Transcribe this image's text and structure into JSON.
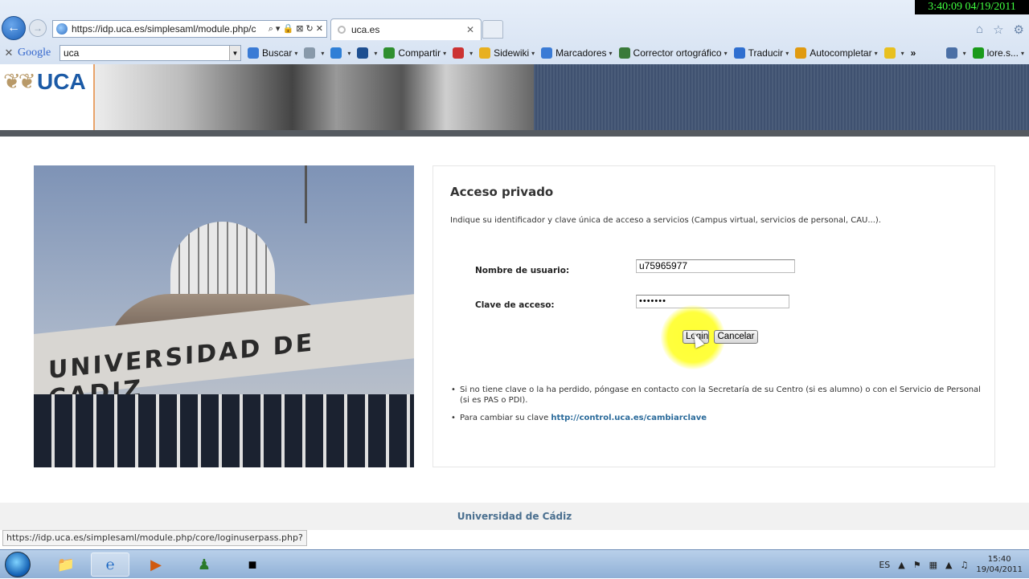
{
  "clock_overlay": "3:40:09  04/19/2011",
  "browser": {
    "address": "https://idp.uca.es/simplesaml/module.php/c",
    "tab_title": "uca.es",
    "tab_close": "✕",
    "address_tools": "⌕ ▾ 🔒 ⊠ ↻ ✕",
    "right_icons": [
      "home-icon",
      "star-icon",
      "gear-icon"
    ]
  },
  "google_toolbar": {
    "logo": "Google",
    "search_value": "uca",
    "items": [
      {
        "label": "Buscar",
        "icon": "search-icon",
        "color": "#3a7bd5"
      },
      {
        "label": "",
        "icon": "page-icon",
        "color": "#8899aa"
      },
      {
        "label": "",
        "icon": "plus-icon",
        "color": "#2f7fd6"
      },
      {
        "label": "",
        "icon": "globe-icon",
        "color": "#1d4f91"
      },
      {
        "label": "Compartir",
        "icon": "share-icon",
        "color": "#2f8f2f"
      },
      {
        "label": "",
        "icon": "pagerank-icon",
        "color": "#cc3333"
      },
      {
        "label": "Sidewiki",
        "icon": "sidewiki-icon",
        "color": "#e8b020"
      },
      {
        "label": "Marcadores",
        "icon": "bookmark-star-icon",
        "color": "#3a7bd5"
      },
      {
        "label": "Corrector ortográfico",
        "icon": "spellcheck-icon",
        "color": "#3a7a3a"
      },
      {
        "label": "Traducir",
        "icon": "translate-icon",
        "color": "#2f6fd0"
      },
      {
        "label": "Autocompletar",
        "icon": "pencil-icon",
        "color": "#e09a10"
      },
      {
        "label": "",
        "icon": "highlighter-icon",
        "color": "#e8c020"
      }
    ],
    "overflow": "»",
    "right": [
      {
        "label": "",
        "icon": "wrench-icon",
        "color": "#4a6fa5"
      },
      {
        "label": "lore.s...",
        "icon": "account-icon",
        "color": "#1a9a1a"
      }
    ]
  },
  "banner": {
    "logo_text": "UCA"
  },
  "campus_image": {
    "sign_text": "UNIVERSIDAD  DE  CADIZ"
  },
  "login": {
    "title": "Acceso privado",
    "description": "Indique su identificador y clave única de acceso a servicios (Campus virtual, servicios de personal, CAU...).",
    "username_label": "Nombre de usuario:",
    "username_value": "u75965977",
    "password_label": "Clave de acceso:",
    "password_value": "•••••••",
    "login_button": "Login",
    "cancel_button": "Cancelar",
    "note_1": "Si no tiene clave o la ha perdido, póngase en contacto con la Secretaría de su Centro (si es alumno) o con el Servicio de Personal (si es PAS o PDI).",
    "note_2_prefix": "Para cambiar su clave ",
    "note_2_link": "http://control.uca.es/cambiarclave"
  },
  "footer": "Universidad de Cádiz",
  "status_url": "https://idp.uca.es/simplesaml/module.php/core/loginuserpass.php?",
  "taskbar": {
    "language": "ES",
    "time": "15:40",
    "date": "19/04/2011"
  }
}
